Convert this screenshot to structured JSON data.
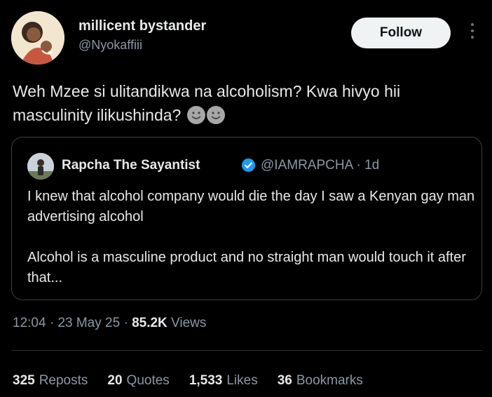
{
  "author": {
    "name": "millicent bystander",
    "handle": "@Nyokaffiii",
    "avatar_icon": "cartoon-avatar-icon"
  },
  "follow_label": "Follow",
  "tweet": {
    "text": "Weh Mzee si ulitandikwa na alcoholism? Kwa hivyo hii masculinity ilikushinda?",
    "emoji": "grinning-face-icon"
  },
  "quote": {
    "name": "Rapcha The Sayantist",
    "meta": "@IAMRAPCHA · 1d",
    "verified_icon": "verified-badge-icon",
    "text": "I knew that alcohol company would die the day I saw a Kenyan gay man advertising alcohol\n\nAlcohol is a masculine product and no straight man would touch it after that..."
  },
  "info": {
    "time": "12:04",
    "date": "23 May 25",
    "views_count": "85.2K",
    "views_label": "Views"
  },
  "stats": [
    {
      "count": "325",
      "label": "Reposts"
    },
    {
      "count": "20",
      "label": "Quotes"
    },
    {
      "count": "1,533",
      "label": "Likes"
    },
    {
      "count": "36",
      "label": "Bookmarks"
    }
  ],
  "colors": {
    "background": "#000000",
    "text": "#e7e9ea",
    "muted": "#8b98a5",
    "verified": "#1d9bf0",
    "follow_bg": "#eff3f4"
  }
}
